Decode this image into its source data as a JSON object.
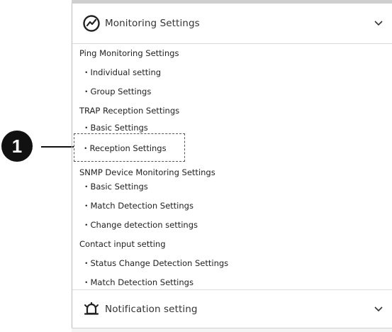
{
  "callout": {
    "number": "1"
  },
  "monitoring_section": {
    "title": "Monitoring Settings",
    "icon": "monitoring-graph-icon",
    "expanded": true,
    "items": [
      {
        "label": "Ping Monitoring Settings",
        "level": 0
      },
      {
        "label": "・Individual setting",
        "level": 1
      },
      {
        "label": "・Group Settings",
        "level": 1
      },
      {
        "label": "TRAP Reception Settings",
        "level": 0
      },
      {
        "label": "・Basic Settings",
        "level": 1
      },
      {
        "label": "・Reception Settings",
        "level": 1,
        "highlighted": true
      },
      {
        "label": "SNMP Device Monitoring Settings",
        "level": 0
      },
      {
        "label": "・Basic Settings",
        "level": 1
      },
      {
        "label": "・Match Detection Settings",
        "level": 1
      },
      {
        "label": "・Change detection settings",
        "level": 1
      },
      {
        "label": "Contact input setting",
        "level": 0
      },
      {
        "label": "・Status Change Detection Settings",
        "level": 1
      },
      {
        "label": "・Match Detection Settings",
        "level": 1
      }
    ]
  },
  "notification_section": {
    "title": "Notification setting",
    "icon": "bell-icon",
    "expanded": false
  }
}
